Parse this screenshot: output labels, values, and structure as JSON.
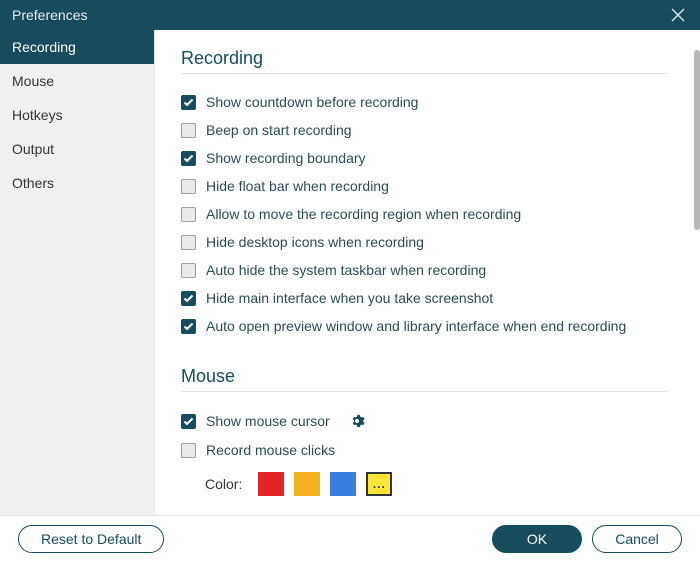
{
  "window": {
    "title": "Preferences"
  },
  "sidebar": {
    "items": [
      {
        "label": "Recording",
        "active": true
      },
      {
        "label": "Mouse",
        "active": false
      },
      {
        "label": "Hotkeys",
        "active": false
      },
      {
        "label": "Output",
        "active": false
      },
      {
        "label": "Others",
        "active": false
      }
    ]
  },
  "sections": {
    "recording": {
      "title": "Recording",
      "options": [
        {
          "label": "Show countdown before recording",
          "checked": true
        },
        {
          "label": "Beep on start recording",
          "checked": false
        },
        {
          "label": "Show recording boundary",
          "checked": true
        },
        {
          "label": "Hide float bar when recording",
          "checked": false
        },
        {
          "label": "Allow to move the recording region when recording",
          "checked": false
        },
        {
          "label": "Hide desktop icons when recording",
          "checked": false
        },
        {
          "label": "Auto hide the system taskbar when recording",
          "checked": false
        },
        {
          "label": "Hide main interface when you take screenshot",
          "checked": true
        },
        {
          "label": "Auto open preview window and library interface when end recording",
          "checked": true
        }
      ]
    },
    "mouse": {
      "title": "Mouse",
      "options": [
        {
          "label": "Show mouse cursor",
          "checked": true,
          "has_gear": true
        },
        {
          "label": "Record mouse clicks",
          "checked": false
        }
      ],
      "color_label": "Color:",
      "colors": [
        {
          "hex": "#e02525"
        },
        {
          "hex": "#f4b223"
        },
        {
          "hex": "#3a7fe0"
        }
      ],
      "more_label": "..."
    }
  },
  "footer": {
    "reset_label": "Reset to Default",
    "ok_label": "OK",
    "cancel_label": "Cancel"
  }
}
